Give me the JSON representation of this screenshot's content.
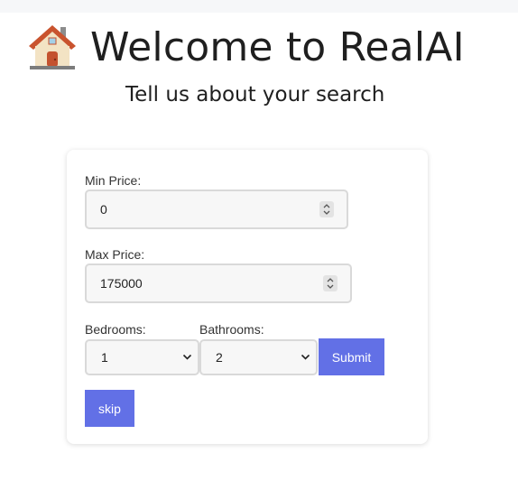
{
  "header": {
    "icon": "house-icon",
    "title": "Welcome to RealAI",
    "subtitle": "Tell us about your search"
  },
  "form": {
    "min_price": {
      "label": "Min Price:",
      "value": "0"
    },
    "max_price": {
      "label": "Max Price:",
      "value": "175000"
    },
    "bedrooms": {
      "label": "Bedrooms:",
      "selected": "1"
    },
    "bathrooms": {
      "label": "Bathrooms:",
      "selected": "2"
    },
    "submit_label": "Submit",
    "skip_label": "skip"
  },
  "colors": {
    "accent": "#6270e6",
    "input_bg": "#f7f7f7",
    "input_border": "#d9d9d9"
  }
}
